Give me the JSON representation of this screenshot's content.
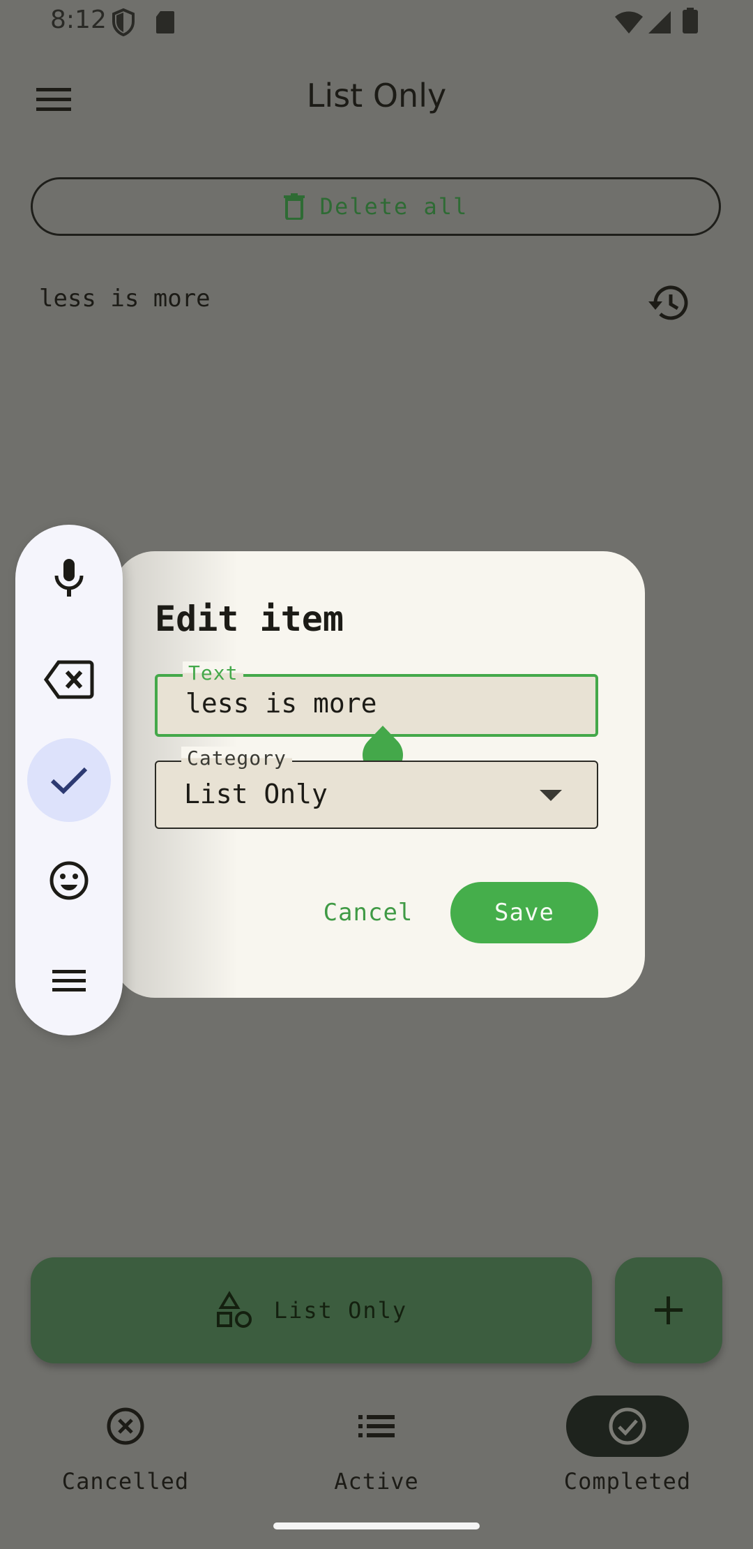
{
  "status_bar": {
    "time": "8:12"
  },
  "app_bar": {
    "title": "List Only"
  },
  "delete_all": {
    "label": "Delete all"
  },
  "list": {
    "items": [
      {
        "text": "less is more"
      }
    ]
  },
  "dialog": {
    "title": "Edit item",
    "text_field": {
      "label": "Text",
      "value": "less is more"
    },
    "category_field": {
      "label": "Category",
      "value": "List Only"
    },
    "cancel_label": "Cancel",
    "save_label": "Save"
  },
  "bottom_bar": {
    "category_label": "List Only",
    "nav": [
      {
        "label": "Cancelled",
        "icon": "cancel-circle-icon"
      },
      {
        "label": "Active",
        "icon": "list-icon"
      },
      {
        "label": "Completed",
        "icon": "check-circle-icon",
        "selected": true
      }
    ]
  },
  "floating_toolbar": {
    "icons": [
      "microphone-icon",
      "backspace-icon",
      "check-icon",
      "emoji-icon",
      "menu-icon"
    ],
    "selected": "check-icon"
  },
  "colors": {
    "accent": "#44a84a",
    "dialog_bg": "#f8f6ef",
    "scrim": "#70706c"
  }
}
